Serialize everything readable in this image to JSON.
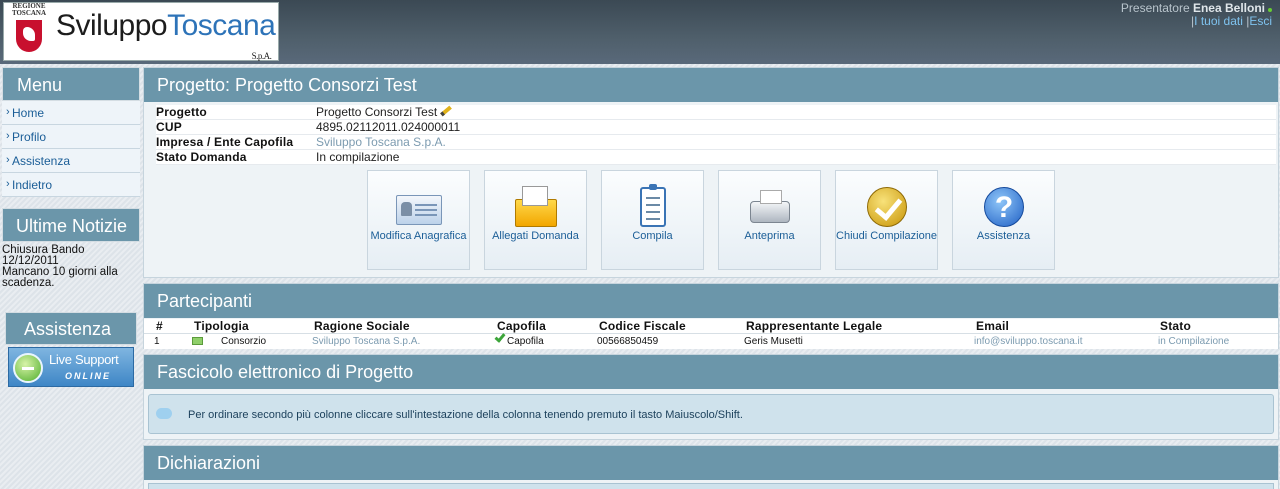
{
  "header": {
    "logo_region": "REGIONE TOSCANA",
    "brand_a": "Sviluppo",
    "brand_b": "Toscana",
    "brand_c": "S.p.A.",
    "user_role": "Presentatore",
    "user_name": "Enea Belloni",
    "link_data": "I tuoi dati",
    "link_exit": "Esci"
  },
  "sidebar": {
    "menu_title": "Menu",
    "items": [
      {
        "label": "Home"
      },
      {
        "label": "Profilo"
      },
      {
        "label": "Assistenza"
      },
      {
        "label": "Indietro"
      }
    ],
    "news_title": "Ultime Notizie",
    "news_l1": "Chiusura Bando",
    "news_l2": "12/12/2011",
    "news_l3": "Mancano 10 giorni alla",
    "news_l4": "scadenza.",
    "assist_title": "Assistenza",
    "live_l1": "Live Support",
    "live_l2": "ONLINE"
  },
  "project": {
    "title": "Progetto: Progetto Consorzi Test",
    "rows": [
      {
        "k": "Progetto",
        "v": "Progetto Consorzi Test"
      },
      {
        "k": "CUP",
        "v": "4895.02112011.024000011"
      },
      {
        "k": "Impresa / Ente Capofila",
        "v": "Sviluppo Toscana S.p.A."
      },
      {
        "k": "Stato Domanda",
        "v": "In compilazione"
      }
    ],
    "actions": [
      {
        "label": "Modifica Anagrafica",
        "icon": "id-card-icon"
      },
      {
        "label": "Allegati Domanda",
        "icon": "folder-icon"
      },
      {
        "label": "Compila",
        "icon": "clipboard-icon"
      },
      {
        "label": "Anteprima",
        "icon": "printer-icon"
      },
      {
        "label": "Chiudi Compilazione",
        "icon": "checkmark-icon"
      },
      {
        "label": "Assistenza",
        "icon": "help-icon"
      }
    ]
  },
  "participants": {
    "title": "Partecipanti",
    "columns": [
      "#",
      "Tipologia",
      "Ragione Sociale",
      "Capofila",
      "Codice Fiscale",
      "Rappresentante Legale",
      "Email",
      "Stato"
    ],
    "rows": [
      [
        "1",
        "Consorzio",
        "Sviluppo Toscana S.p.A.",
        "Capofila",
        "00566850459",
        "Geris Musetti",
        "info@sviluppo.toscana.it",
        "in Compilazione"
      ]
    ]
  },
  "fascicolo": {
    "title": "Fascicolo elettronico di Progetto",
    "note": "Per ordinare secondo più colonne cliccare sull'intestazione della colonna tenendo premuto il tasto Maiuscolo/Shift."
  },
  "dichiarazioni": {
    "title": "Dichiarazioni"
  }
}
